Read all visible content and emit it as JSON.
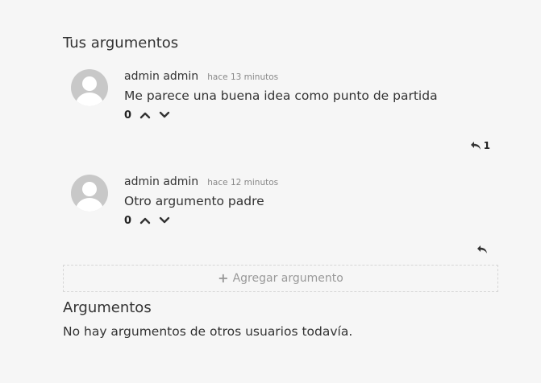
{
  "own_section": {
    "title": "Tus argumentos"
  },
  "arguments": [
    {
      "author": "admin admin",
      "time": "hace 13 minutos",
      "text": "Me parece una buena idea como punto de partida",
      "votes": "0",
      "reply_count": "1"
    },
    {
      "author": "admin admin",
      "time": "hace 12 minutos",
      "text": "Otro argumento padre",
      "votes": "0",
      "reply_count": ""
    }
  ],
  "add_argument": {
    "icon": "plus-icon",
    "label": "Agregar argumento"
  },
  "others_section": {
    "title": "Argumentos",
    "empty_message": "No hay argumentos de otros usuarios todavía."
  },
  "icons": {
    "avatar": "default-user-avatar",
    "upvote": "chevron-up-icon",
    "downvote": "chevron-down-icon",
    "reply": "reply-icon"
  },
  "colors": {
    "background": "#f6f6f6",
    "text": "#333333",
    "muted": "#999999",
    "avatar": "#c8c8c8"
  }
}
